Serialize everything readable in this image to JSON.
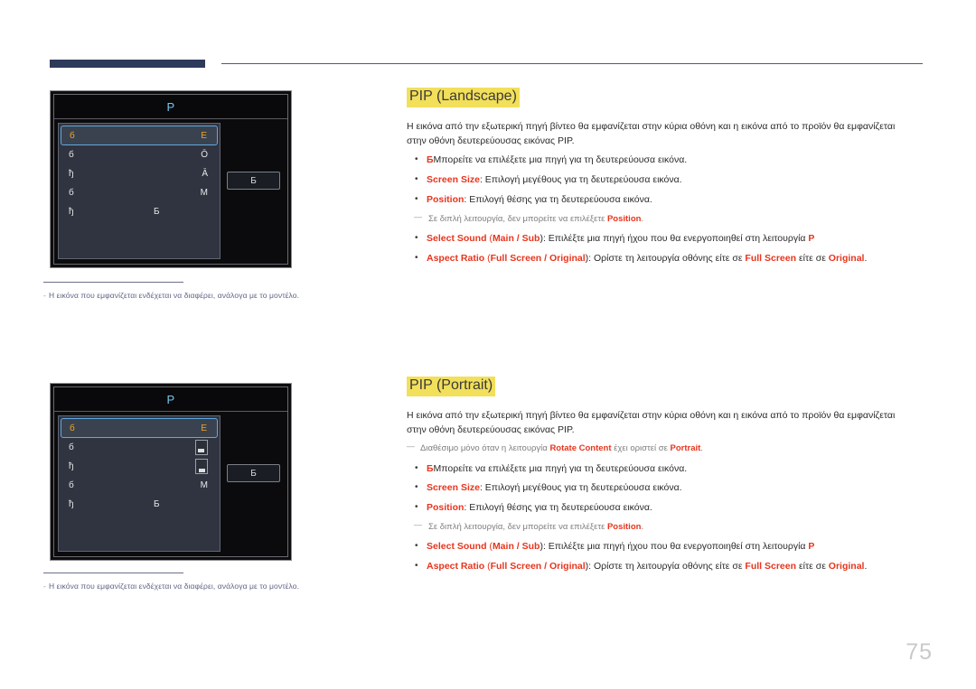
{
  "page": {
    "number": "75"
  },
  "panels": [
    {
      "name": "landscape-osd",
      "title": "P",
      "chip": "Б",
      "rows": [
        {
          "label": "б",
          "value": "Е",
          "selected": true,
          "value_type": "text"
        },
        {
          "label": "б",
          "value": "Ō",
          "selected": false,
          "value_type": "text"
        },
        {
          "label": "ђ",
          "value": "Ā",
          "selected": false,
          "value_type": "text"
        },
        {
          "label": "б",
          "value": "М",
          "selected": false,
          "value_type": "text"
        },
        {
          "label": "ђ",
          "value": "Б",
          "selected": false,
          "value_type": "text",
          "center": true
        }
      ]
    },
    {
      "name": "portrait-osd",
      "title": "P",
      "chip": "Б",
      "rows": [
        {
          "label": "б",
          "value": "Е",
          "selected": true,
          "value_type": "text"
        },
        {
          "label": "б",
          "value": "",
          "selected": false,
          "value_type": "screen-icon"
        },
        {
          "label": "ђ",
          "value": "",
          "selected": false,
          "value_type": "screen-icon-low"
        },
        {
          "label": "б",
          "value": "М",
          "selected": false,
          "value_type": "text"
        },
        {
          "label": "ђ",
          "value": "Б",
          "selected": false,
          "value_type": "text",
          "center": true
        }
      ]
    }
  ],
  "captions": {
    "dash": "-",
    "landscape": "Η εικόνα που εμφανίζεται ενδέχεται να διαφέρει, ανάλογα με το μοντέλο.",
    "portrait": "Η εικόνα που εμφανίζεται ενδέχεται να διαφέρει, ανάλογα με το μοντέλο."
  },
  "sections": {
    "landscape": {
      "heading": "PIP (Landscape)",
      "intro": "Η εικόνα από την εξωτερική πηγή βίντεο θα εμφανίζεται στην κύρια οθόνη και η εικόνα από το προϊόν θα εμφανίζεται στην οθόνη δευτερεύουσας εικόνας PIP.",
      "bullets": {
        "b1_glyph": "Б",
        "b1_text": "Μπορείτε να επιλέξετε μια πηγή για τη δευτερεύουσα εικόνα.",
        "b2_key": "Screen Size",
        "b2_text": ": Επιλογή μεγέθους για τη δευτερεύουσα εικόνα.",
        "b3_key": "Position",
        "b3_text": ": Επιλογή θέσης για τη δευτερεύουσα εικόνα.",
        "note1_pre": "Σε διπλή λειτουργία, δεν μπορείτε να επιλέξετε ",
        "note1_key": "Position",
        "note1_post": ".",
        "b4_key": "Select Sound",
        "b4_paren_open": " (",
        "b4_opt1": "Main",
        "b4_sep": " / ",
        "b4_opt2": "Sub",
        "b4_paren_close": ")",
        "b4_text": ": Επιλέξτε μια πηγή ήχου που θα ενεργοποιηθεί στη λειτουργία ",
        "b4_tail": "P",
        "b5_key": "Aspect Ratio",
        "b5_paren_open": " (",
        "b5_opt1": "Full Screen",
        "b5_sep": " / ",
        "b5_opt2": "Original",
        "b5_paren_close": ")",
        "b5_text": ": Ορίστε τη λειτουργία οθόνης είτε σε ",
        "b5_opt3": "Full Screen",
        "b5_mid": " είτε σε ",
        "b5_opt4": "Original",
        "b5_end": "."
      }
    },
    "portrait": {
      "heading": "PIP (Portrait)",
      "intro": "Η εικόνα από την εξωτερική πηγή βίντεο θα εμφανίζεται στην κύρια οθόνη και η εικόνα από το προϊόν θα εμφανίζεται στην οθόνη δευτερεύουσας εικόνας PIP.",
      "topnote_pre": "Διαθέσιμο μόνο όταν η λειτουργία ",
      "topnote_key1": "Rotate Content",
      "topnote_mid": " έχει οριστεί σε ",
      "topnote_key2": "Portrait",
      "topnote_post": ".",
      "bullets": {
        "b1_glyph": "Б",
        "b1_text": "Μπορείτε να επιλέξετε μια πηγή για τη δευτερεύουσα εικόνα.",
        "b2_key": "Screen Size",
        "b2_text": ": Επιλογή μεγέθους για τη δευτερεύουσα εικόνα.",
        "b3_key": "Position",
        "b3_text": ": Επιλογή θέσης για τη δευτερεύουσα εικόνα.",
        "note1_pre": "Σε διπλή λειτουργία, δεν μπορείτε να επιλέξετε ",
        "note1_key": "Position",
        "note1_post": ".",
        "b4_key": "Select Sound",
        "b4_paren_open": " (",
        "b4_opt1": "Main",
        "b4_sep": " / ",
        "b4_opt2": "Sub",
        "b4_paren_close": ")",
        "b4_text": ": Επιλέξτε μια πηγή ήχου που θα ενεργοποιηθεί στη λειτουργία ",
        "b4_tail": "P",
        "b5_key": "Aspect Ratio",
        "b5_paren_open": " (",
        "b5_opt1": "Full Screen",
        "b5_sep": " / ",
        "b5_opt2": "Original",
        "b5_paren_close": ")",
        "b5_text": ": Ορίστε τη λειτουργία οθόνης είτε σε ",
        "b5_opt3": "Full Screen",
        "b5_mid": " είτε σε ",
        "b5_opt4": "Original",
        "b5_end": "."
      }
    }
  },
  "colors": {
    "highlight": "#f2df5a",
    "keyword": "#e8341c",
    "osd_selected": "#f0a81e",
    "osd_title": "#74c6ea",
    "rule": "#2e3a5c"
  }
}
